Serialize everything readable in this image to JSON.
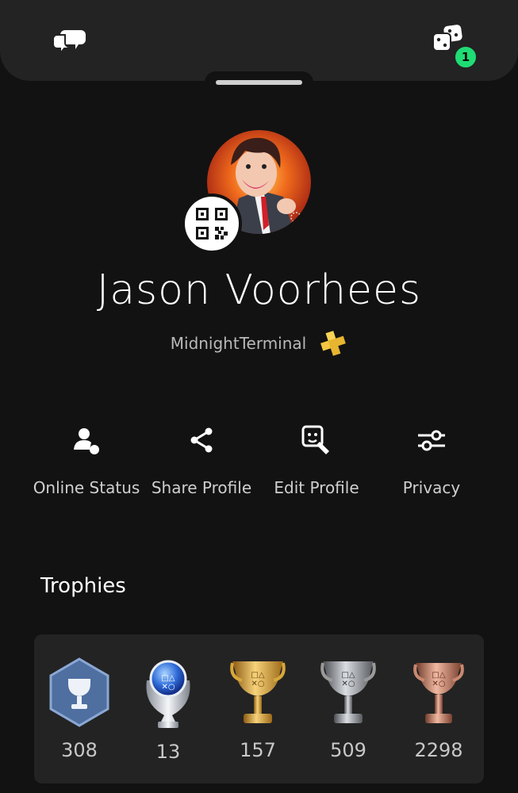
{
  "topbar": {
    "chat_icon": "chat-bubbles-icon",
    "game_icon": "gaming-icon",
    "notification_count": "1",
    "badge_color": "#1fdc74"
  },
  "profile": {
    "display_name": "Jason Voorhees",
    "online_id": "MidnightTerminal",
    "plus_icon": "playstation-plus-icon",
    "qr_icon": "qr-code-icon"
  },
  "actions": [
    {
      "label": "Online Status",
      "icon": "online-status-icon"
    },
    {
      "label": "Share Profile",
      "icon": "share-icon"
    },
    {
      "label": "Edit Profile",
      "icon": "edit-profile-icon"
    },
    {
      "label": "Privacy",
      "icon": "sliders-icon"
    }
  ],
  "trophies": {
    "title": "Trophies",
    "items": [
      {
        "type": "level",
        "count": "308"
      },
      {
        "type": "platinum",
        "count": "13"
      },
      {
        "type": "gold",
        "count": "157"
      },
      {
        "type": "silver",
        "count": "509"
      },
      {
        "type": "bronze",
        "count": "2298"
      }
    ]
  },
  "colors": {
    "background": "#121212",
    "surface": "#232323",
    "gold": "#d8a73a",
    "silver": "#9a9a9a",
    "bronze": "#c98870",
    "level": "#4f6fa0",
    "platinum": "#2f6cd9"
  }
}
